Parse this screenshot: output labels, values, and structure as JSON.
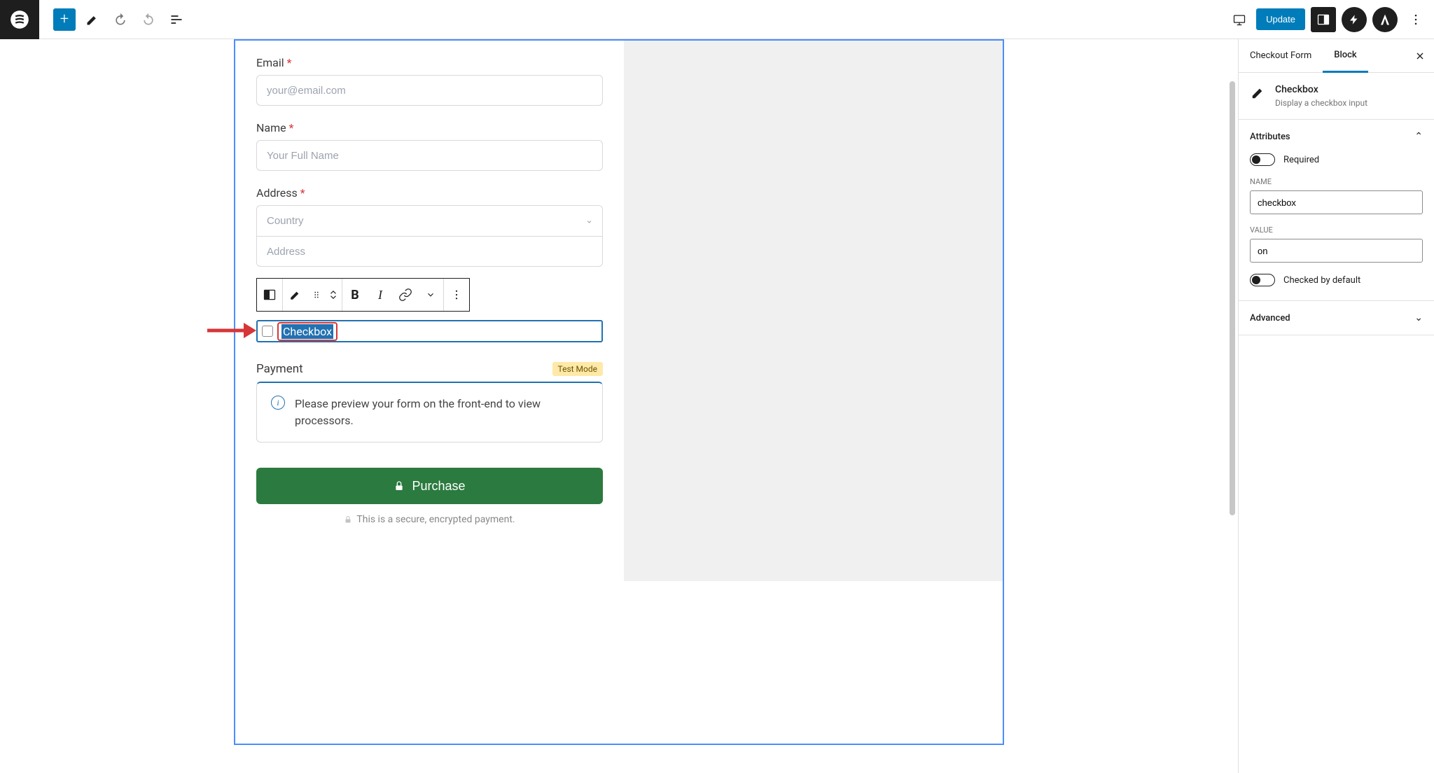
{
  "toolbar": {
    "update_label": "Update"
  },
  "form": {
    "email": {
      "label": "Email",
      "placeholder": "your@email.com"
    },
    "name": {
      "label": "Name",
      "placeholder": "Your Full Name"
    },
    "address": {
      "label": "Address",
      "country_placeholder": "Country",
      "street_placeholder": "Address"
    },
    "checkbox_field": {
      "label": "Checkbox"
    },
    "payment": {
      "label": "Payment",
      "badge": "Test Mode",
      "info_text": "Please preview your form on the front-end to view processors."
    },
    "purchase_label": "Purchase",
    "secure_text": "This is a secure, encrypted payment."
  },
  "sidebar": {
    "tabs": {
      "checkout": "Checkout Form",
      "block": "Block"
    },
    "block": {
      "title": "Checkbox",
      "description": "Display a checkbox input"
    },
    "panels": {
      "attributes": {
        "title": "Attributes",
        "required_label": "Required",
        "name_label": "NAME",
        "name_value": "checkbox",
        "value_label": "VALUE",
        "value_value": "on",
        "checked_default_label": "Checked by default"
      },
      "advanced": {
        "title": "Advanced"
      }
    }
  }
}
